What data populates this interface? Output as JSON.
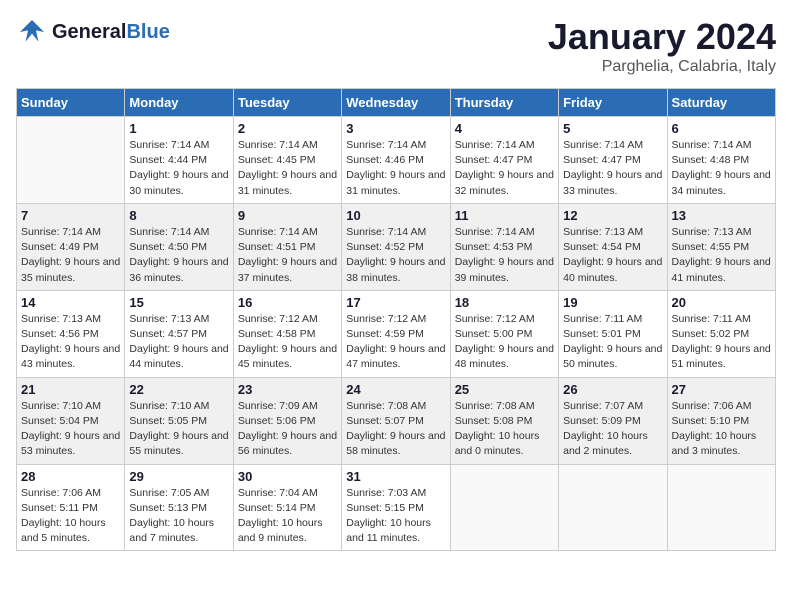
{
  "logo": {
    "general": "General",
    "blue": "Blue"
  },
  "header": {
    "title": "January 2024",
    "location": "Parghelia, Calabria, Italy"
  },
  "weekdays": [
    "Sunday",
    "Monday",
    "Tuesday",
    "Wednesday",
    "Thursday",
    "Friday",
    "Saturday"
  ],
  "weeks": [
    [
      {
        "day": "",
        "sunrise": "",
        "sunset": "",
        "daylight": ""
      },
      {
        "day": "1",
        "sunrise": "Sunrise: 7:14 AM",
        "sunset": "Sunset: 4:44 PM",
        "daylight": "Daylight: 9 hours and 30 minutes."
      },
      {
        "day": "2",
        "sunrise": "Sunrise: 7:14 AM",
        "sunset": "Sunset: 4:45 PM",
        "daylight": "Daylight: 9 hours and 31 minutes."
      },
      {
        "day": "3",
        "sunrise": "Sunrise: 7:14 AM",
        "sunset": "Sunset: 4:46 PM",
        "daylight": "Daylight: 9 hours and 31 minutes."
      },
      {
        "day": "4",
        "sunrise": "Sunrise: 7:14 AM",
        "sunset": "Sunset: 4:47 PM",
        "daylight": "Daylight: 9 hours and 32 minutes."
      },
      {
        "day": "5",
        "sunrise": "Sunrise: 7:14 AM",
        "sunset": "Sunset: 4:47 PM",
        "daylight": "Daylight: 9 hours and 33 minutes."
      },
      {
        "day": "6",
        "sunrise": "Sunrise: 7:14 AM",
        "sunset": "Sunset: 4:48 PM",
        "daylight": "Daylight: 9 hours and 34 minutes."
      }
    ],
    [
      {
        "day": "7",
        "sunrise": "Sunrise: 7:14 AM",
        "sunset": "Sunset: 4:49 PM",
        "daylight": "Daylight: 9 hours and 35 minutes."
      },
      {
        "day": "8",
        "sunrise": "Sunrise: 7:14 AM",
        "sunset": "Sunset: 4:50 PM",
        "daylight": "Daylight: 9 hours and 36 minutes."
      },
      {
        "day": "9",
        "sunrise": "Sunrise: 7:14 AM",
        "sunset": "Sunset: 4:51 PM",
        "daylight": "Daylight: 9 hours and 37 minutes."
      },
      {
        "day": "10",
        "sunrise": "Sunrise: 7:14 AM",
        "sunset": "Sunset: 4:52 PM",
        "daylight": "Daylight: 9 hours and 38 minutes."
      },
      {
        "day": "11",
        "sunrise": "Sunrise: 7:14 AM",
        "sunset": "Sunset: 4:53 PM",
        "daylight": "Daylight: 9 hours and 39 minutes."
      },
      {
        "day": "12",
        "sunrise": "Sunrise: 7:13 AM",
        "sunset": "Sunset: 4:54 PM",
        "daylight": "Daylight: 9 hours and 40 minutes."
      },
      {
        "day": "13",
        "sunrise": "Sunrise: 7:13 AM",
        "sunset": "Sunset: 4:55 PM",
        "daylight": "Daylight: 9 hours and 41 minutes."
      }
    ],
    [
      {
        "day": "14",
        "sunrise": "Sunrise: 7:13 AM",
        "sunset": "Sunset: 4:56 PM",
        "daylight": "Daylight: 9 hours and 43 minutes."
      },
      {
        "day": "15",
        "sunrise": "Sunrise: 7:13 AM",
        "sunset": "Sunset: 4:57 PM",
        "daylight": "Daylight: 9 hours and 44 minutes."
      },
      {
        "day": "16",
        "sunrise": "Sunrise: 7:12 AM",
        "sunset": "Sunset: 4:58 PM",
        "daylight": "Daylight: 9 hours and 45 minutes."
      },
      {
        "day": "17",
        "sunrise": "Sunrise: 7:12 AM",
        "sunset": "Sunset: 4:59 PM",
        "daylight": "Daylight: 9 hours and 47 minutes."
      },
      {
        "day": "18",
        "sunrise": "Sunrise: 7:12 AM",
        "sunset": "Sunset: 5:00 PM",
        "daylight": "Daylight: 9 hours and 48 minutes."
      },
      {
        "day": "19",
        "sunrise": "Sunrise: 7:11 AM",
        "sunset": "Sunset: 5:01 PM",
        "daylight": "Daylight: 9 hours and 50 minutes."
      },
      {
        "day": "20",
        "sunrise": "Sunrise: 7:11 AM",
        "sunset": "Sunset: 5:02 PM",
        "daylight": "Daylight: 9 hours and 51 minutes."
      }
    ],
    [
      {
        "day": "21",
        "sunrise": "Sunrise: 7:10 AM",
        "sunset": "Sunset: 5:04 PM",
        "daylight": "Daylight: 9 hours and 53 minutes."
      },
      {
        "day": "22",
        "sunrise": "Sunrise: 7:10 AM",
        "sunset": "Sunset: 5:05 PM",
        "daylight": "Daylight: 9 hours and 55 minutes."
      },
      {
        "day": "23",
        "sunrise": "Sunrise: 7:09 AM",
        "sunset": "Sunset: 5:06 PM",
        "daylight": "Daylight: 9 hours and 56 minutes."
      },
      {
        "day": "24",
        "sunrise": "Sunrise: 7:08 AM",
        "sunset": "Sunset: 5:07 PM",
        "daylight": "Daylight: 9 hours and 58 minutes."
      },
      {
        "day": "25",
        "sunrise": "Sunrise: 7:08 AM",
        "sunset": "Sunset: 5:08 PM",
        "daylight": "Daylight: 10 hours and 0 minutes."
      },
      {
        "day": "26",
        "sunrise": "Sunrise: 7:07 AM",
        "sunset": "Sunset: 5:09 PM",
        "daylight": "Daylight: 10 hours and 2 minutes."
      },
      {
        "day": "27",
        "sunrise": "Sunrise: 7:06 AM",
        "sunset": "Sunset: 5:10 PM",
        "daylight": "Daylight: 10 hours and 3 minutes."
      }
    ],
    [
      {
        "day": "28",
        "sunrise": "Sunrise: 7:06 AM",
        "sunset": "Sunset: 5:11 PM",
        "daylight": "Daylight: 10 hours and 5 minutes."
      },
      {
        "day": "29",
        "sunrise": "Sunrise: 7:05 AM",
        "sunset": "Sunset: 5:13 PM",
        "daylight": "Daylight: 10 hours and 7 minutes."
      },
      {
        "day": "30",
        "sunrise": "Sunrise: 7:04 AM",
        "sunset": "Sunset: 5:14 PM",
        "daylight": "Daylight: 10 hours and 9 minutes."
      },
      {
        "day": "31",
        "sunrise": "Sunrise: 7:03 AM",
        "sunset": "Sunset: 5:15 PM",
        "daylight": "Daylight: 10 hours and 11 minutes."
      },
      {
        "day": "",
        "sunrise": "",
        "sunset": "",
        "daylight": ""
      },
      {
        "day": "",
        "sunrise": "",
        "sunset": "",
        "daylight": ""
      },
      {
        "day": "",
        "sunrise": "",
        "sunset": "",
        "daylight": ""
      }
    ]
  ]
}
